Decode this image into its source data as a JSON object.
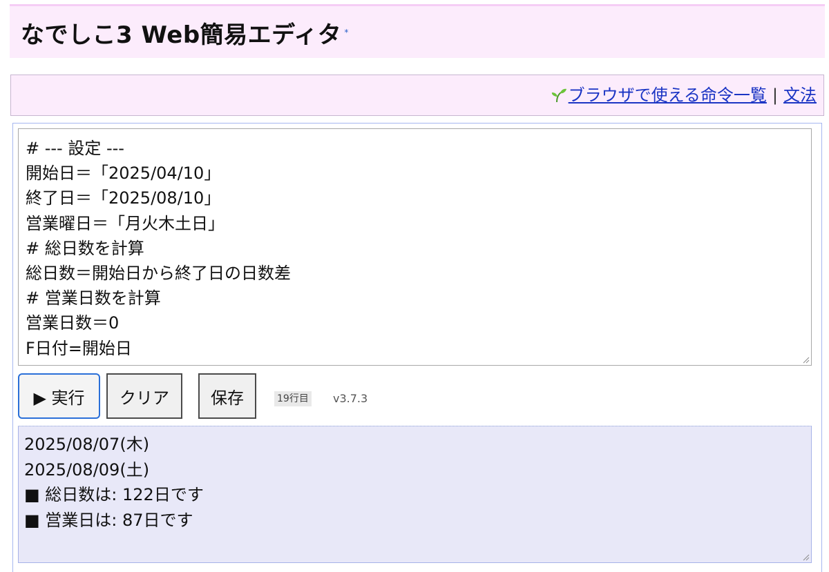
{
  "header": {
    "title": "なでしこ3 Web簡易エディタ",
    "title_mark": "*"
  },
  "links": {
    "sprout_icon": "sprout-icon",
    "commands_label": "ブラウザで使える命令一覧",
    "separator": "|",
    "grammar_label": "文法"
  },
  "editor": {
    "lines": [
      "# --- 設定 ---",
      "開始日＝「2025/04/10」",
      "終了日＝「2025/08/10」",
      "営業曜日＝「月火木土日」",
      "# 総日数を計算",
      "総日数＝開始日から終了日の日数差",
      "# 営業日数を計算",
      "営業日数＝0",
      "F日付=開始日"
    ]
  },
  "toolbar": {
    "run_label": "▶ 実行",
    "clear_label": "クリア",
    "save_label": "保存",
    "line_count": "19行目",
    "version": "v3.7.3"
  },
  "output": {
    "lines": [
      "2025/08/07(木)",
      "2025/08/09(土)",
      "■ 総日数は: 122日です",
      "■ 営業日は: 87日です"
    ]
  },
  "colors": {
    "title_bg": "#fcecfc",
    "link": "#1a34c4",
    "run_border": "#2a6fd8",
    "output_bg": "#e8e8f8"
  }
}
